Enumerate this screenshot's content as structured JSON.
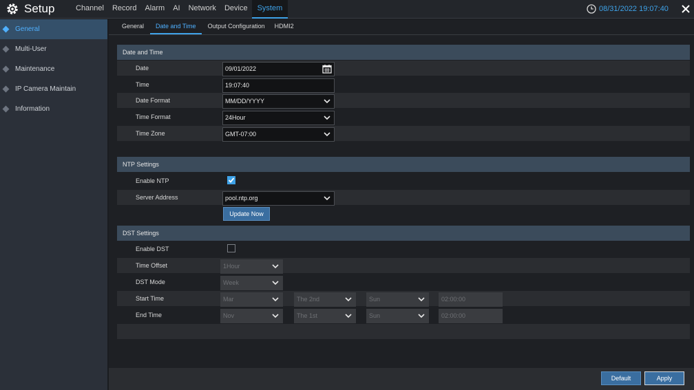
{
  "header": {
    "app_title": "Setup",
    "app_icon": "gear-icon",
    "nav": [
      "Channel",
      "Record",
      "Alarm",
      "AI",
      "Network",
      "Device",
      "System"
    ],
    "active_nav": "System",
    "datetime": "08/31/2022 19:07:40",
    "accent_color": "#3ea2e8"
  },
  "sidebar": {
    "items": [
      "General",
      "Multi-User",
      "Maintenance",
      "IP Camera Maintain",
      "Information"
    ],
    "active": "General"
  },
  "subtabs": {
    "items": [
      "General",
      "Date and Time",
      "Output Configuration",
      "HDMI2"
    ],
    "active": "Date and Time"
  },
  "date_time": {
    "title": "Date and Time",
    "date_label": "Date",
    "date_value": "09/01/2022",
    "time_label": "Time",
    "time_value": "19:07:40",
    "date_format_label": "Date Format",
    "date_format_value": "MM/DD/YYYY",
    "time_format_label": "Time Format",
    "time_format_value": "24Hour",
    "time_zone_label": "Time Zone",
    "time_zone_value": "GMT-07:00"
  },
  "ntp": {
    "title": "NTP Settings",
    "enable_label": "Enable NTP",
    "enabled": true,
    "server_label": "Server Address",
    "server_value": "pool.ntp.org",
    "update_button": "Update Now"
  },
  "dst": {
    "title": "DST Settings",
    "enable_label": "Enable DST",
    "enabled": false,
    "time_offset_label": "Time Offset",
    "time_offset_value": "1Hour",
    "mode_label": "DST Mode",
    "mode_value": "Week",
    "start_label": "Start Time",
    "start_month": "Mar",
    "start_week": "The 2nd",
    "start_day": "Sun",
    "start_time": "02:00:00",
    "end_label": "End Time",
    "end_month": "Nov",
    "end_week": "The 1st",
    "end_day": "Sun",
    "end_time": "02:00:00"
  },
  "footer": {
    "default_button": "Default",
    "apply_button": "Apply"
  }
}
